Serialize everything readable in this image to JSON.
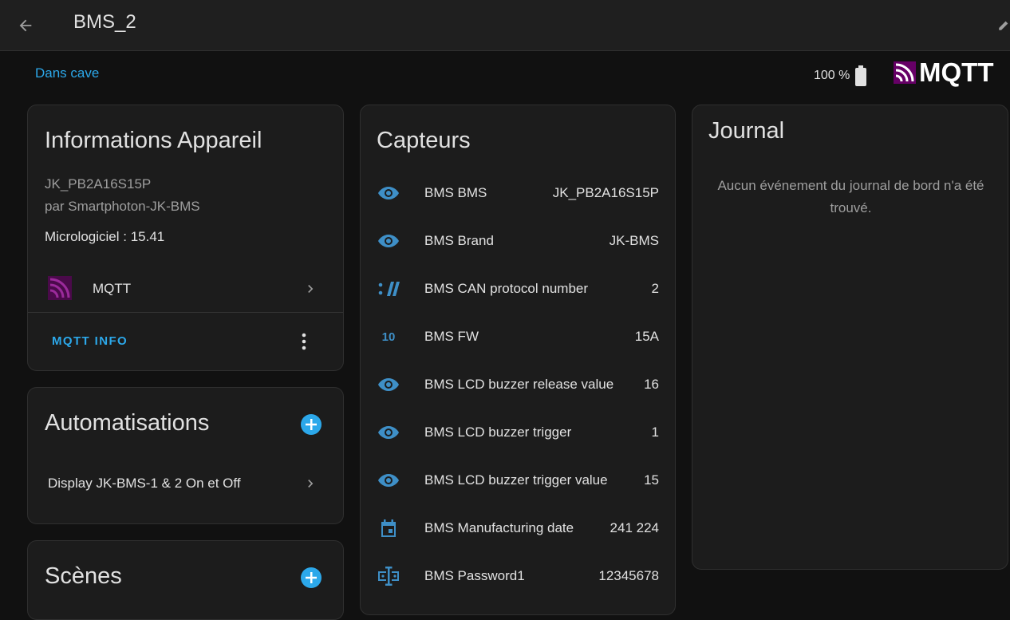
{
  "header": {
    "title": "BMS_2"
  },
  "area": {
    "label": "Dans cave"
  },
  "battery": {
    "text": "100 %"
  },
  "mqtt_logo": {
    "text": "MQTT"
  },
  "device_card": {
    "title": "Informations Appareil",
    "model": "JK_PB2A16S15P",
    "manufacturer": "par Smartphoton-JK-BMS",
    "firmware": "Micrologiciel : 15.41",
    "integration": "MQTT",
    "info_button": "MQTT INFO"
  },
  "automations": {
    "title": "Automatisations",
    "items": [
      {
        "label": "Display JK-BMS-1 & 2 On et Off"
      }
    ]
  },
  "scenes": {
    "title": "Scènes"
  },
  "sensors": {
    "title": "Capteurs",
    "items": [
      {
        "icon": "eye-icon",
        "name": "BMS BMS",
        "value": "JK_PB2A16S15P"
      },
      {
        "icon": "eye-icon",
        "name": "BMS Brand",
        "value": "JK-BMS"
      },
      {
        "icon": "numeric-icon",
        "name": "BMS CAN protocol number",
        "value": "2"
      },
      {
        "icon": "binary-icon",
        "name": "BMS FW",
        "value": "15A"
      },
      {
        "icon": "eye-icon",
        "name": "BMS LCD buzzer release value",
        "value": "16"
      },
      {
        "icon": "eye-icon",
        "name": "BMS LCD buzzer trigger",
        "value": "1"
      },
      {
        "icon": "eye-icon",
        "name": "BMS LCD buzzer trigger value",
        "value": "15"
      },
      {
        "icon": "calendar-icon",
        "name": "BMS Manufacturing date",
        "value": "241 224"
      },
      {
        "icon": "password-icon",
        "name": "BMS Password1",
        "value": "12345678"
      }
    ]
  },
  "journal": {
    "title": "Journal",
    "empty_text": "Aucun événement du journal de bord n'a été trouvé."
  },
  "colors": {
    "accent": "#2ca8ea",
    "icon": "#3e8fc7",
    "mqtt_purple": "#660066"
  }
}
